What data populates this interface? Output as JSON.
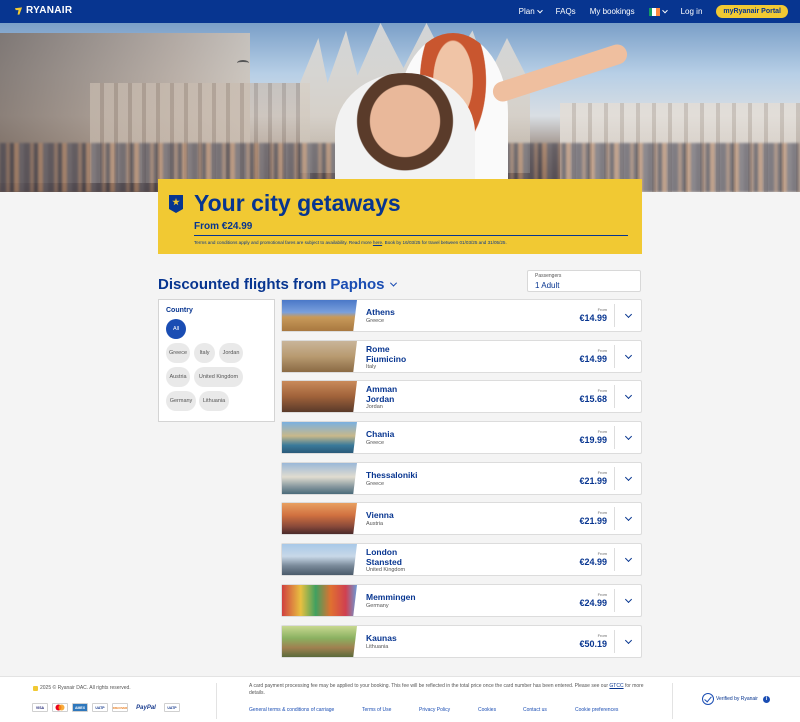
{
  "header": {
    "logo_text": "RYANAIR",
    "nav": {
      "plan": "Plan",
      "faqs": "FAQs",
      "my_bookings": "My bookings",
      "login": "Log in",
      "portal": "myRyanair Portal"
    },
    "colors": {
      "brand_blue": "#073590",
      "brand_yellow": "#f1c933"
    }
  },
  "promo": {
    "title": "Your city getaways",
    "from_price": "From €24.99",
    "terms_before": "Terms and conditions apply and promotional fares are subject to availability. Read more ",
    "terms_link": "here",
    "terms_after": ". Book by 16/03/25 for travel between 01/03/25 and 31/05/25."
  },
  "section": {
    "title_prefix": "Discounted flights from",
    "origin": "Paphos"
  },
  "passengers": {
    "label": "Passengers",
    "value": "1 Adult"
  },
  "filter": {
    "title": "Country",
    "options": [
      "All",
      "Greece",
      "Italy",
      "Jordan",
      "Austria",
      "United Kingdom",
      "Germany",
      "Lithuania"
    ],
    "selected": "All"
  },
  "flights": [
    {
      "city_line1": "Athens",
      "city_line2": "",
      "country": "Greece",
      "from_label": "From",
      "price": "€14.99"
    },
    {
      "city_line1": "Rome",
      "city_line2": "Fiumicino",
      "country": "Italy",
      "from_label": "From",
      "price": "€14.99"
    },
    {
      "city_line1": "Amman",
      "city_line2": "Jordan",
      "country": "Jordan",
      "from_label": "From",
      "price": "€15.68"
    },
    {
      "city_line1": "Chania",
      "city_line2": "",
      "country": "Greece",
      "from_label": "From",
      "price": "€19.99"
    },
    {
      "city_line1": "Thessaloniki",
      "city_line2": "",
      "country": "Greece",
      "from_label": "From",
      "price": "€21.99"
    },
    {
      "city_line1": "Vienna",
      "city_line2": "",
      "country": "Austria",
      "from_label": "From",
      "price": "€21.99"
    },
    {
      "city_line1": "London",
      "city_line2": "Stansted",
      "country": "United Kingdom",
      "from_label": "From",
      "price": "€24.99"
    },
    {
      "city_line1": "Memmingen",
      "city_line2": "",
      "country": "Germany",
      "from_label": "From",
      "price": "€24.99"
    },
    {
      "city_line1": "Kaunas",
      "city_line2": "",
      "country": "Lithuania",
      "from_label": "From",
      "price": "€50.19"
    }
  ],
  "footer": {
    "copyright": "2025 © Ryanair DAC. All rights reserved.",
    "payment_methods": [
      "VISA",
      "MC",
      "AMEX",
      "UATP",
      "DISCOVER",
      "PayPal",
      "UATP"
    ],
    "note_before": "A card payment processing fee may be applied to your booking. This fee will be reflected in the total price once the card number has been entered. Please see our ",
    "note_link": "GTCC",
    "note_after": " for more details.",
    "links": [
      "General terms & conditions of carriage",
      "Terms of Use",
      "Privacy Policy",
      "Cookies",
      "Contact us",
      "Cookie preferences"
    ],
    "verified": "Verified by Ryanair"
  }
}
